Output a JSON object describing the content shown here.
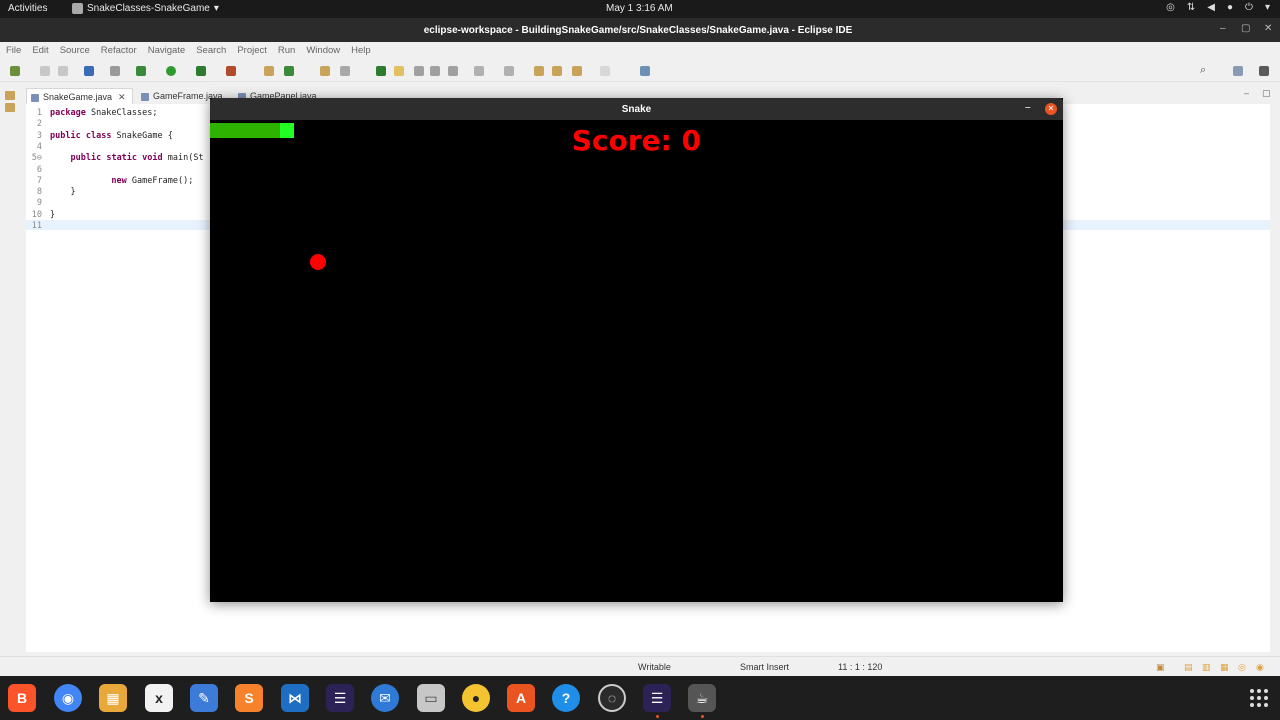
{
  "topbar": {
    "activities": "Activities",
    "app_name": "SnakeClasses-SnakeGame",
    "clock": "May 1  3:16 AM"
  },
  "eclipse": {
    "title": "eclipse-workspace - BuildingSnakeGame/src/SnakeClasses/SnakeGame.java - Eclipse IDE",
    "menu": [
      "File",
      "Edit",
      "Source",
      "Refactor",
      "Navigate",
      "Search",
      "Project",
      "Run",
      "Window",
      "Help"
    ],
    "tabs": [
      {
        "label": "SnakeGame.java",
        "active": true
      },
      {
        "label": "GameFrame.java",
        "active": false
      },
      {
        "label": "GamePanel.java",
        "active": false
      }
    ],
    "code": [
      {
        "n": "1",
        "text": "package SnakeClasses;"
      },
      {
        "n": "2",
        "text": ""
      },
      {
        "n": "3",
        "text": "public class SnakeGame {"
      },
      {
        "n": "4",
        "text": ""
      },
      {
        "n": "5⊖",
        "text": "    public static void main(St"
      },
      {
        "n": "6",
        "text": ""
      },
      {
        "n": "7",
        "text": "            new GameFrame();"
      },
      {
        "n": "8",
        "text": "    }"
      },
      {
        "n": "9",
        "text": ""
      },
      {
        "n": "10",
        "text": "}"
      },
      {
        "n": "11",
        "text": ""
      }
    ],
    "status": {
      "writable": "Writable",
      "insert_mode": "Smart Insert",
      "position": "11 : 1 : 120"
    }
  },
  "snake_window": {
    "title": "Snake",
    "score_label": "Score: 0",
    "score": 0,
    "colors": {
      "body": "#2db300",
      "head": "#22ff22",
      "apple": "#ff0000",
      "score": "#ff0000",
      "board": "#000000"
    },
    "snake_length": 6,
    "head_direction": "right"
  },
  "dock": {
    "apps": [
      "brave-icon",
      "chrome-icon",
      "calc-sheet-icon",
      "math-icon",
      "text-editor-icon",
      "sublime-icon",
      "vscode-icon",
      "eclipse-icon",
      "thunderbird-icon",
      "files-icon",
      "rhythmbox-icon",
      "software-center-icon",
      "help-icon",
      "obs-icon",
      "eclipse-2-icon",
      "java-app-icon"
    ]
  }
}
